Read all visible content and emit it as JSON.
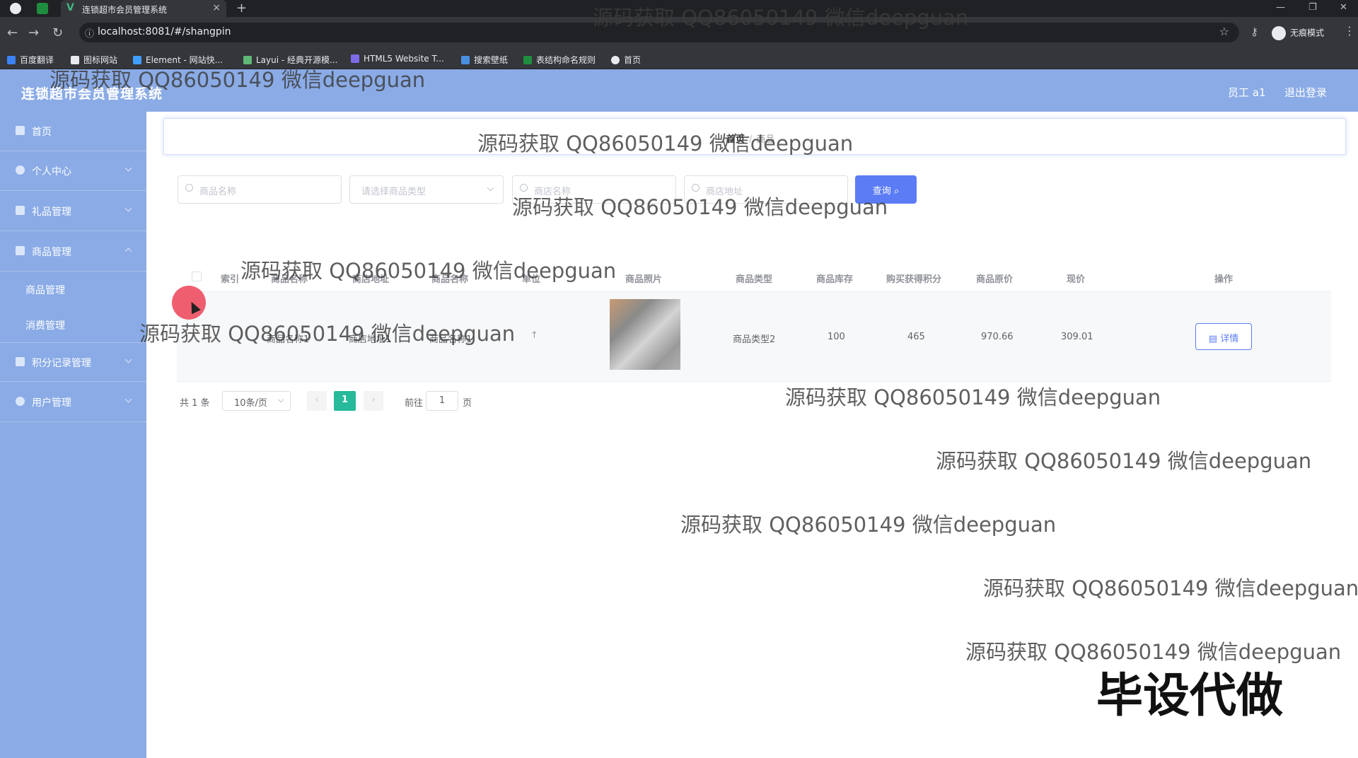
{
  "browser": {
    "tab_title": "连锁超市会员管理系统",
    "tab_close": "×",
    "new_tab": "+",
    "url": "localhost:8081/#/shangpin",
    "incognito_label": "无痕模式",
    "bookmarks": [
      "百度翻译",
      "图标网站",
      "Element - 网站快...",
      "Layui - 经典开源模...",
      "HTML5 Website T...",
      "搜索壁纸",
      "表结构命名规则",
      "首页"
    ]
  },
  "header": {
    "title": "连锁超市会员管理系统",
    "user": "员工 a1",
    "logout": "退出登录"
  },
  "sidebar": {
    "items": [
      {
        "label": "首页"
      },
      {
        "label": "个人中心"
      },
      {
        "label": "礼品管理"
      },
      {
        "label": "商品管理"
      },
      {
        "label": "积分记录管理"
      },
      {
        "label": "用户管理"
      }
    ],
    "sub_items": [
      {
        "label": "商品管理"
      },
      {
        "label": "消费管理"
      }
    ]
  },
  "breadcrumb": {
    "home": "首页",
    "separator": "/",
    "current": "商品"
  },
  "search": {
    "product_name_placeholder": "商品名称",
    "type_placeholder": "请选择商品类型",
    "store_name_placeholder": "商店名称",
    "store_address_placeholder": "商店地址",
    "query_label": "查询"
  },
  "table": {
    "headers": [
      "索引",
      "商品名称",
      "商店地址",
      "商品名称",
      "单位",
      "商品照片",
      "商品类型",
      "商品库存",
      "购买获得积分",
      "商品原价",
      "现价",
      "操作"
    ],
    "rows": [
      {
        "name": "商品名称1",
        "address": "商店地址1",
        "store": "商品名称1",
        "type": "商品类型2",
        "stock": "100",
        "points": "465",
        "original_price": "970.66",
        "price": "309.01",
        "action": "详情"
      }
    ]
  },
  "pagination": {
    "total": "共 1 条",
    "page_size": "10条/页",
    "prev": "‹",
    "current_page": "1",
    "next": "›",
    "goto_label": "前往",
    "goto_value": "1",
    "page_label": "页"
  },
  "overlay": {
    "watermark": "源码获取 QQ86050149 微信deepguan",
    "big_text": "毕设代做"
  }
}
